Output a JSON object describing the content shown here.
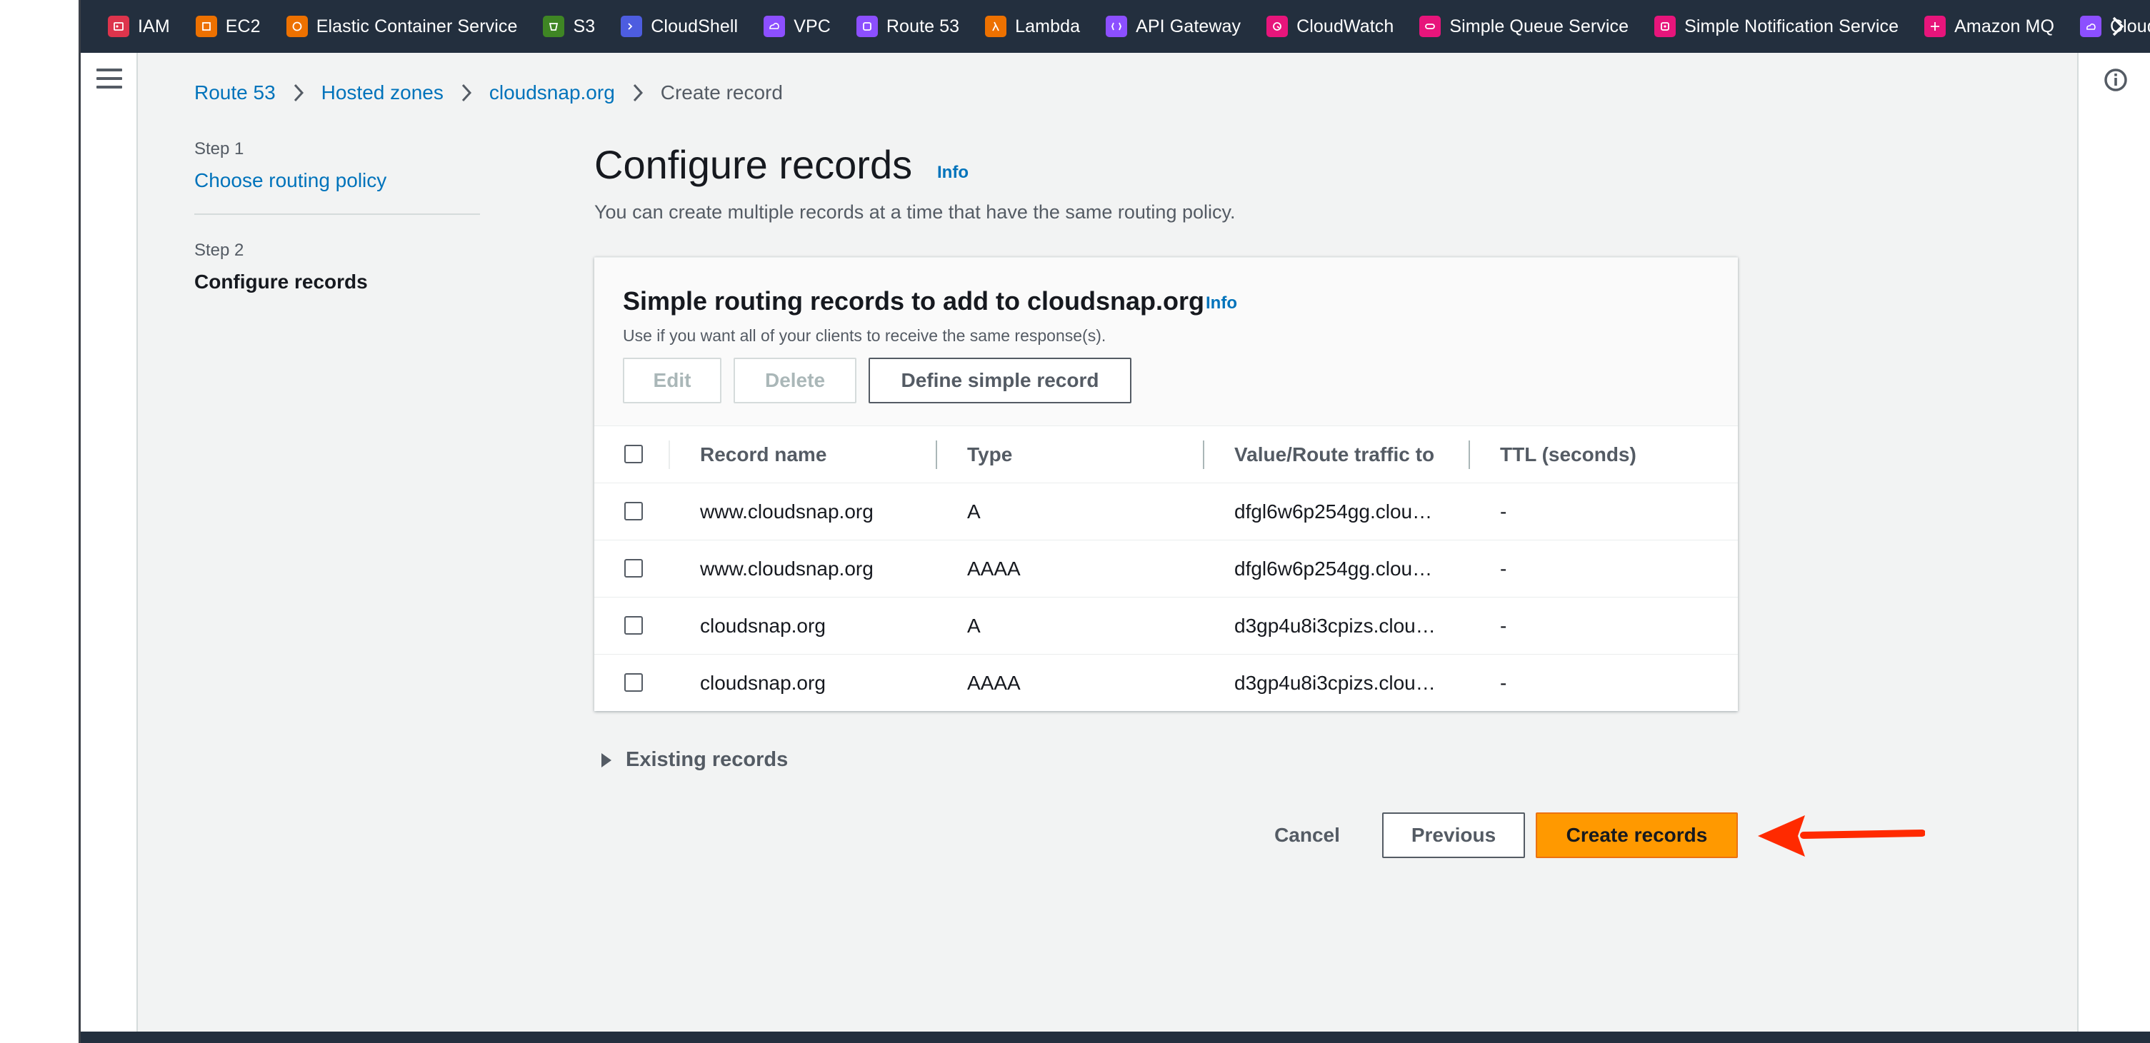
{
  "favorites": [
    {
      "label": "IAM",
      "icon": "iam-icon",
      "color": "#dd344c"
    },
    {
      "label": "EC2",
      "icon": "ec2-icon",
      "color": "#ed7100"
    },
    {
      "label": "Elastic Container Service",
      "icon": "ecs-icon",
      "color": "#ed7100"
    },
    {
      "label": "S3",
      "icon": "s3-icon",
      "color": "#3f8624"
    },
    {
      "label": "CloudShell",
      "icon": "cloudshell-icon",
      "color": "#4d5de0"
    },
    {
      "label": "VPC",
      "icon": "vpc-icon",
      "color": "#8c4fff"
    },
    {
      "label": "Route 53",
      "icon": "route53-icon",
      "color": "#8c4fff"
    },
    {
      "label": "Lambda",
      "icon": "lambda-icon",
      "color": "#ed7100"
    },
    {
      "label": "API Gateway",
      "icon": "api-gateway-icon",
      "color": "#8c4fff"
    },
    {
      "label": "CloudWatch",
      "icon": "cloudwatch-icon",
      "color": "#e7157b"
    },
    {
      "label": "Simple Queue Service",
      "icon": "sqs-icon",
      "color": "#e7157b"
    },
    {
      "label": "Simple Notification Service",
      "icon": "sns-icon",
      "color": "#e7157b"
    },
    {
      "label": "Amazon MQ",
      "icon": "amazon-mq-icon",
      "color": "#e7157b"
    },
    {
      "label": "Cloud",
      "icon": "cloud-service-icon",
      "color": "#8c4fff"
    }
  ],
  "breadcrumb": {
    "items": [
      "Route 53",
      "Hosted zones",
      "cloudsnap.org"
    ],
    "current": "Create record"
  },
  "steps": {
    "step1_num": "Step 1",
    "step1_label": "Choose routing policy",
    "step2_num": "Step 2",
    "step2_label": "Configure records"
  },
  "main": {
    "title": "Configure records",
    "info": "Info",
    "description": "You can create multiple records at a time that have the same routing policy."
  },
  "card": {
    "title": "Simple routing records to add to cloudsnap.org",
    "info": "Info",
    "description": "Use if you want all of your clients to receive the same response(s).",
    "edit_label": "Edit",
    "delete_label": "Delete",
    "define_label": "Define simple record"
  },
  "table": {
    "headers": [
      "Record name",
      "Type",
      "Value/Route traffic to",
      "TTL (seconds)"
    ],
    "rows": [
      {
        "name": "www.cloudsnap.org",
        "type": "A",
        "value": "dfgl6w6p254gg.clou…",
        "ttl": "-"
      },
      {
        "name": "www.cloudsnap.org",
        "type": "AAAA",
        "value": "dfgl6w6p254gg.clou…",
        "ttl": "-"
      },
      {
        "name": "cloudsnap.org",
        "type": "A",
        "value": "d3gp4u8i3cpizs.clou…",
        "ttl": "-"
      },
      {
        "name": "cloudsnap.org",
        "type": "AAAA",
        "value": "d3gp4u8i3cpizs.clou…",
        "ttl": "-"
      }
    ]
  },
  "existing_records_label": "Existing records",
  "footer": {
    "cancel_label": "Cancel",
    "previous_label": "Previous",
    "create_label": "Create records"
  },
  "colors": {
    "accent_orange": "#ff9900",
    "link_blue": "#0073bb",
    "topbar": "#232f3e",
    "annotation_red": "#ff2a00"
  }
}
